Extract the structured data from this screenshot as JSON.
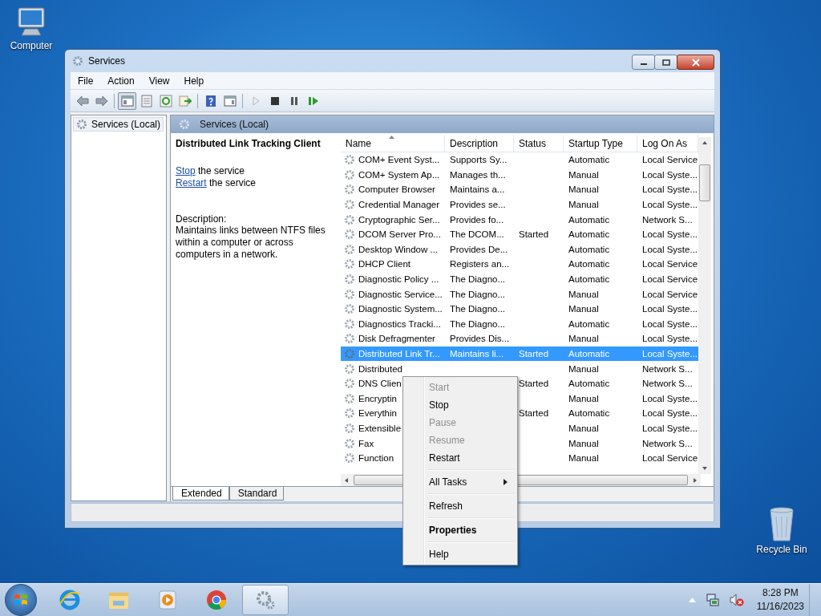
{
  "desktop_icons": [
    {
      "label": "Computer",
      "kind": "computer"
    },
    {
      "label": "Recycle Bin",
      "kind": "recycle"
    }
  ],
  "window": {
    "title": "Services"
  },
  "menu_bar": [
    "File",
    "Action",
    "View",
    "Help"
  ],
  "toolbar": [
    {
      "kind": "back",
      "pressed": false,
      "disabled": false
    },
    {
      "kind": "forward",
      "pressed": false,
      "disabled": false
    },
    {
      "kind": "console-tree",
      "pressed": true,
      "disabled": false
    },
    {
      "kind": "properties",
      "pressed": false,
      "disabled": false
    },
    {
      "kind": "refresh",
      "pressed": false,
      "disabled": false
    },
    {
      "kind": "export",
      "pressed": false,
      "disabled": false
    },
    {
      "kind": "help",
      "pressed": false,
      "disabled": false
    },
    {
      "kind": "action-pane",
      "pressed": false,
      "disabled": false
    },
    {
      "kind": "start",
      "pressed": false,
      "disabled": true
    },
    {
      "kind": "stop",
      "pressed": false,
      "disabled": false
    },
    {
      "kind": "pause",
      "pressed": false,
      "disabled": false
    },
    {
      "kind": "restart",
      "pressed": false,
      "disabled": false
    }
  ],
  "tree": [
    {
      "label": "Services (Local)",
      "selected": true
    }
  ],
  "pane_header": "Services (Local)",
  "details": {
    "title": "Distributed Link Tracking Client",
    "actions": [
      {
        "link": "Stop",
        "text": "the service"
      },
      {
        "link": "Restart",
        "text": "the service"
      }
    ],
    "description_label": "Description:",
    "description": "Maintains links between NTFS files within a computer or across computers in a network."
  },
  "table": {
    "columns": [
      {
        "label": "Name",
        "sorted": true
      },
      {
        "label": "Description",
        "sorted": false
      },
      {
        "label": "Status",
        "sorted": false
      },
      {
        "label": "Startup Type",
        "sorted": false
      },
      {
        "label": "Log On As",
        "sorted": false
      }
    ],
    "rows": [
      {
        "name": "COM+ Event Syst...",
        "description": "Supports Sy...",
        "status": "",
        "startup_type": "Automatic",
        "log_on_as": "Local Service",
        "selected": false
      },
      {
        "name": "COM+ System Ap...",
        "description": "Manages th...",
        "status": "",
        "startup_type": "Manual",
        "log_on_as": "Local Syste...",
        "selected": false
      },
      {
        "name": "Computer Browser",
        "description": "Maintains a...",
        "status": "",
        "startup_type": "Manual",
        "log_on_as": "Local Syste...",
        "selected": false
      },
      {
        "name": "Credential Manager",
        "description": "Provides se...",
        "status": "",
        "startup_type": "Manual",
        "log_on_as": "Local Syste...",
        "selected": false
      },
      {
        "name": "Cryptographic Ser...",
        "description": "Provides fo...",
        "status": "",
        "startup_type": "Automatic",
        "log_on_as": "Network S...",
        "selected": false
      },
      {
        "name": "DCOM Server Pro...",
        "description": "The DCOM...",
        "status": "Started",
        "startup_type": "Automatic",
        "log_on_as": "Local Syste...",
        "selected": false
      },
      {
        "name": "Desktop Window ...",
        "description": "Provides De...",
        "status": "",
        "startup_type": "Automatic",
        "log_on_as": "Local Syste...",
        "selected": false
      },
      {
        "name": "DHCP Client",
        "description": "Registers an...",
        "status": "",
        "startup_type": "Automatic",
        "log_on_as": "Local Service",
        "selected": false
      },
      {
        "name": "Diagnostic Policy ...",
        "description": "The Diagno...",
        "status": "",
        "startup_type": "Automatic",
        "log_on_as": "Local Service",
        "selected": false
      },
      {
        "name": "Diagnostic Service...",
        "description": "The Diagno...",
        "status": "",
        "startup_type": "Manual",
        "log_on_as": "Local Service",
        "selected": false
      },
      {
        "name": "Diagnostic System...",
        "description": "The Diagno...",
        "status": "",
        "startup_type": "Manual",
        "log_on_as": "Local Syste...",
        "selected": false
      },
      {
        "name": "Diagnostics Tracki...",
        "description": "The Diagno...",
        "status": "",
        "startup_type": "Automatic",
        "log_on_as": "Local Syste...",
        "selected": false
      },
      {
        "name": "Disk Defragmenter",
        "description": "Provides Dis...",
        "status": "",
        "startup_type": "Manual",
        "log_on_as": "Local Syste...",
        "selected": false
      },
      {
        "name": "Distributed Link Tr...",
        "description": "Maintains li...",
        "status": "Started",
        "startup_type": "Automatic",
        "log_on_as": "Local Syste...",
        "selected": true
      },
      {
        "name": "Distributed",
        "status": "",
        "startup_type": "Manual",
        "log_on_as": "Network S...",
        "selected": false
      },
      {
        "name": "DNS Clien",
        "status": "Started",
        "startup_type": "Automatic",
        "log_on_as": "Network S...",
        "selected": false
      },
      {
        "name": "Encryptin",
        "status": "",
        "startup_type": "Manual",
        "log_on_as": "Local Syste...",
        "selected": false
      },
      {
        "name": "Everythin",
        "status": "Started",
        "startup_type": "Automatic",
        "log_on_as": "Local Syste...",
        "selected": false
      },
      {
        "name": "Extensible",
        "status": "",
        "startup_type": "Manual",
        "log_on_as": "Local Syste...",
        "selected": false
      },
      {
        "name": "Fax",
        "status": "",
        "startup_type": "Manual",
        "log_on_as": "Network S...",
        "selected": false
      },
      {
        "name": "Function",
        "status": "",
        "startup_type": "Manual",
        "log_on_as": "Local Service",
        "selected": false
      }
    ]
  },
  "view_tabs": [
    {
      "label": "Extended",
      "selected": true
    },
    {
      "label": "Standard",
      "selected": false
    }
  ],
  "context_menu": [
    {
      "kind": "item",
      "label": "Start",
      "disabled": true,
      "bold": false,
      "submenu": false
    },
    {
      "kind": "item",
      "label": "Stop",
      "disabled": false,
      "bold": false,
      "submenu": false
    },
    {
      "kind": "item",
      "label": "Pause",
      "disabled": true,
      "bold": false,
      "submenu": false
    },
    {
      "kind": "item",
      "label": "Resume",
      "disabled": true,
      "bold": false,
      "submenu": false
    },
    {
      "kind": "item",
      "label": "Restart",
      "disabled": false,
      "bold": false,
      "submenu": false
    },
    {
      "kind": "separator"
    },
    {
      "kind": "item",
      "label": "All Tasks",
      "disabled": false,
      "bold": false,
      "submenu": true
    },
    {
      "kind": "separator"
    },
    {
      "kind": "item",
      "label": "Refresh",
      "disabled": false,
      "bold": false,
      "submenu": false
    },
    {
      "kind": "separator"
    },
    {
      "kind": "item",
      "label": "Properties",
      "disabled": false,
      "bold": true,
      "submenu": false
    },
    {
      "kind": "separator"
    },
    {
      "kind": "item",
      "label": "Help",
      "disabled": false,
      "bold": false,
      "submenu": false
    }
  ],
  "taskbar": {
    "apps": [
      {
        "kind": "browser-e",
        "selected": false
      },
      {
        "kind": "folder",
        "selected": false
      },
      {
        "kind": "media",
        "selected": false
      },
      {
        "kind": "chrome",
        "selected": false
      },
      {
        "kind": "gear",
        "selected": true
      }
    ],
    "time": "8:28 PM",
    "date": "11/16/2023"
  }
}
